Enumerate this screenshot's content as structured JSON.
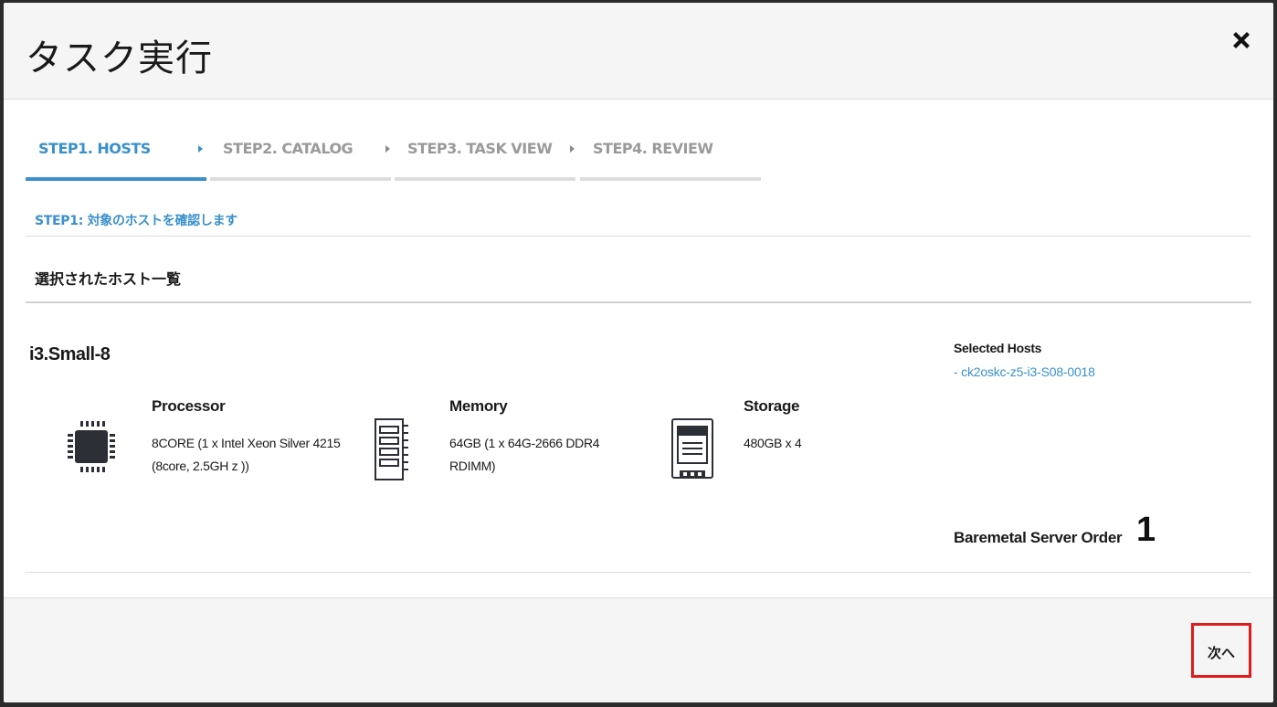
{
  "dialog": {
    "title": "タスク実行",
    "close_icon": "close-icon"
  },
  "steps": [
    {
      "label": "STEP1. HOSTS",
      "active": true
    },
    {
      "label": "STEP2. CATALOG",
      "active": false
    },
    {
      "label": "STEP3. TASK VIEW",
      "active": false
    },
    {
      "label": "STEP4. REVIEW",
      "active": false
    }
  ],
  "step_description": "STEP1: 対象のホストを確認します",
  "section_title": "選択されたホスト一覧",
  "host": {
    "name": "i3.Small-8",
    "specs": [
      {
        "title": "Processor",
        "value": "8CORE (1 x Intel Xeon Silver 4215 (8core, 2.5GH z ))",
        "icon": "cpu-icon"
      },
      {
        "title": "Memory",
        "value": "64GB (1 x 64G-2666 DDR4 RDIMM)",
        "icon": "memory-icon"
      },
      {
        "title": "Storage",
        "value": "480GB x 4",
        "icon": "storage-icon"
      }
    ],
    "selected_hosts_title": "Selected Hosts",
    "selected_hosts": [
      "-  ck2oskc-z5-i3-S08-0018"
    ],
    "order_label": "Baremetal Server Order",
    "order_count": "1"
  },
  "footer": {
    "next_label": "次へ"
  },
  "colors": {
    "accent": "#3a90cc",
    "highlight": "#e01b1b"
  }
}
